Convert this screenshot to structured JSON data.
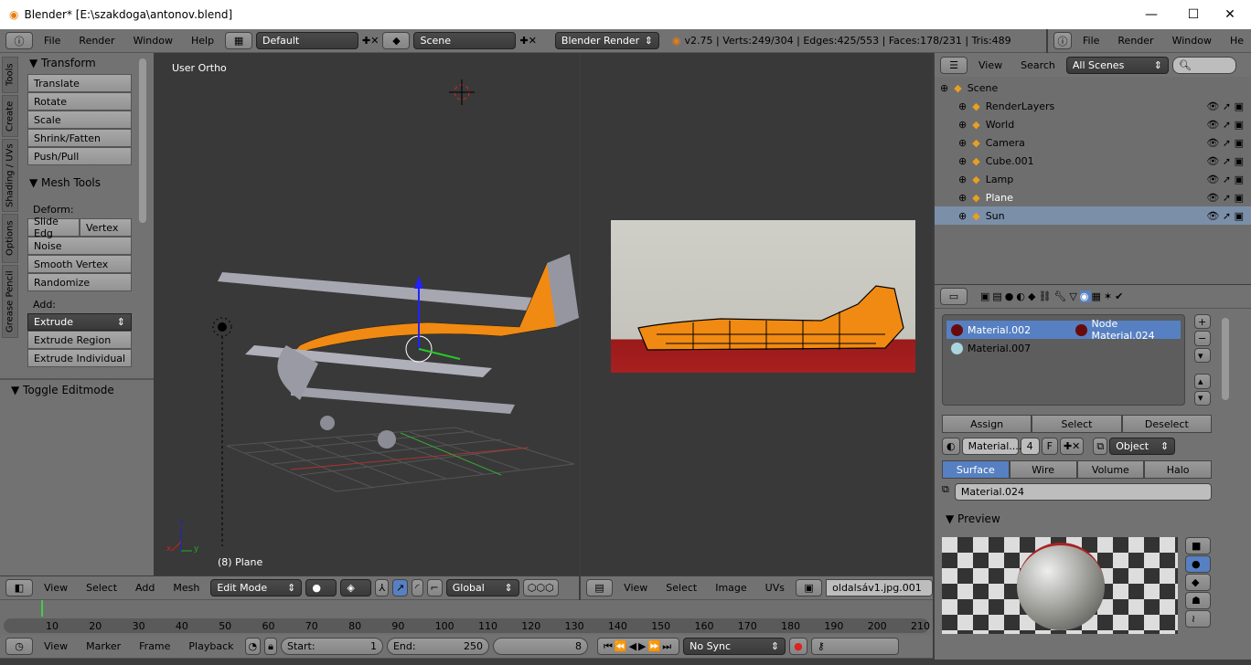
{
  "window": {
    "title": "Blender* [E:\\szakdoga\\antonov.blend]",
    "minimize": "—",
    "maximize": "☐",
    "close": "✕"
  },
  "topbar": {
    "menus": [
      "File",
      "Render",
      "Window",
      "Help"
    ],
    "layout": "Default",
    "scene": "Scene",
    "engine": "Blender Render",
    "stats": "v2.75 | Verts:249/304 | Edges:425/553 | Faces:178/231 | Tris:489",
    "menus2": [
      "File",
      "Render",
      "Window",
      "He"
    ]
  },
  "toolshelf": {
    "tabs": [
      "Tools",
      "Create",
      "Shading / UVs",
      "Options",
      "Grease Pencil"
    ],
    "transform_title": "Transform",
    "transform": [
      "Translate",
      "Rotate",
      "Scale",
      "Shrink/Fatten",
      "Push/Pull"
    ],
    "mesh_tools_title": "Mesh Tools",
    "deform_label": "Deform:",
    "slide_edge": "Slide Edg",
    "vertex": "Vertex",
    "deform": [
      "Noise",
      "Smooth Vertex",
      "Randomize"
    ],
    "add_label": "Add:",
    "extrude": "Extrude",
    "add": [
      "Extrude Region",
      "Extrude Individual"
    ],
    "toggle_editmode": "Toggle Editmode"
  },
  "viewport": {
    "view_label": "User Ortho",
    "object_label": "(8) Plane",
    "axis_x": "x",
    "axis_y": "y",
    "axis_z": "z"
  },
  "viewport_header": {
    "menus": [
      "View",
      "Select",
      "Add",
      "Mesh"
    ],
    "mode": "Edit Mode",
    "orientation": "Global"
  },
  "uv_header": {
    "menus": [
      "View",
      "Select",
      "Image",
      "UVs"
    ],
    "image": "oldalsáv1.jpg.001"
  },
  "timeline": {
    "ticks": [
      "10",
      "20",
      "30",
      "40",
      "50",
      "60",
      "70",
      "80",
      "90",
      "100",
      "110",
      "120",
      "130",
      "140",
      "150",
      "160",
      "170",
      "180",
      "190",
      "200",
      "210"
    ],
    "current_frame": 8
  },
  "timeline_header": {
    "menus": [
      "View",
      "Marker",
      "Frame",
      "Playback"
    ],
    "start_label": "Start:",
    "start": "1",
    "end_label": "End:",
    "end": "250",
    "frame": "8",
    "sync": "No Sync"
  },
  "outliner": {
    "menus": [
      "View",
      "Search"
    ],
    "filter": "All Scenes",
    "items": [
      {
        "name": "Scene",
        "depth": 0
      },
      {
        "name": "RenderLayers",
        "depth": 1
      },
      {
        "name": "World",
        "depth": 1
      },
      {
        "name": "Camera",
        "depth": 1
      },
      {
        "name": "Cube.001",
        "depth": 1
      },
      {
        "name": "Lamp",
        "depth": 1
      },
      {
        "name": "Plane",
        "depth": 1,
        "highlight": true
      },
      {
        "name": "Sun",
        "depth": 1,
        "selected": true
      }
    ]
  },
  "properties": {
    "materials": [
      {
        "name": "Material.002",
        "color": "#6a0b0b"
      },
      {
        "name": "Node Material.024",
        "color": "#6a0b0b"
      },
      {
        "name": "Material.007",
        "color": "#a9d6de"
      }
    ],
    "assign": "Assign",
    "select": "Select",
    "deselect": "Deselect",
    "material_field": "Material....",
    "users": "4",
    "fake": "F",
    "link": "Object",
    "tabs": [
      "Surface",
      "Wire",
      "Volume",
      "Halo"
    ],
    "active_tab": "Surface",
    "material_name": "Material.024",
    "preview_title": "Preview"
  },
  "colors": {
    "accent": "#5680c2",
    "selected_row": "#7b8fa8",
    "orange": "#ff8c00",
    "viewport_bg": "#393939",
    "panel": "#727272"
  }
}
